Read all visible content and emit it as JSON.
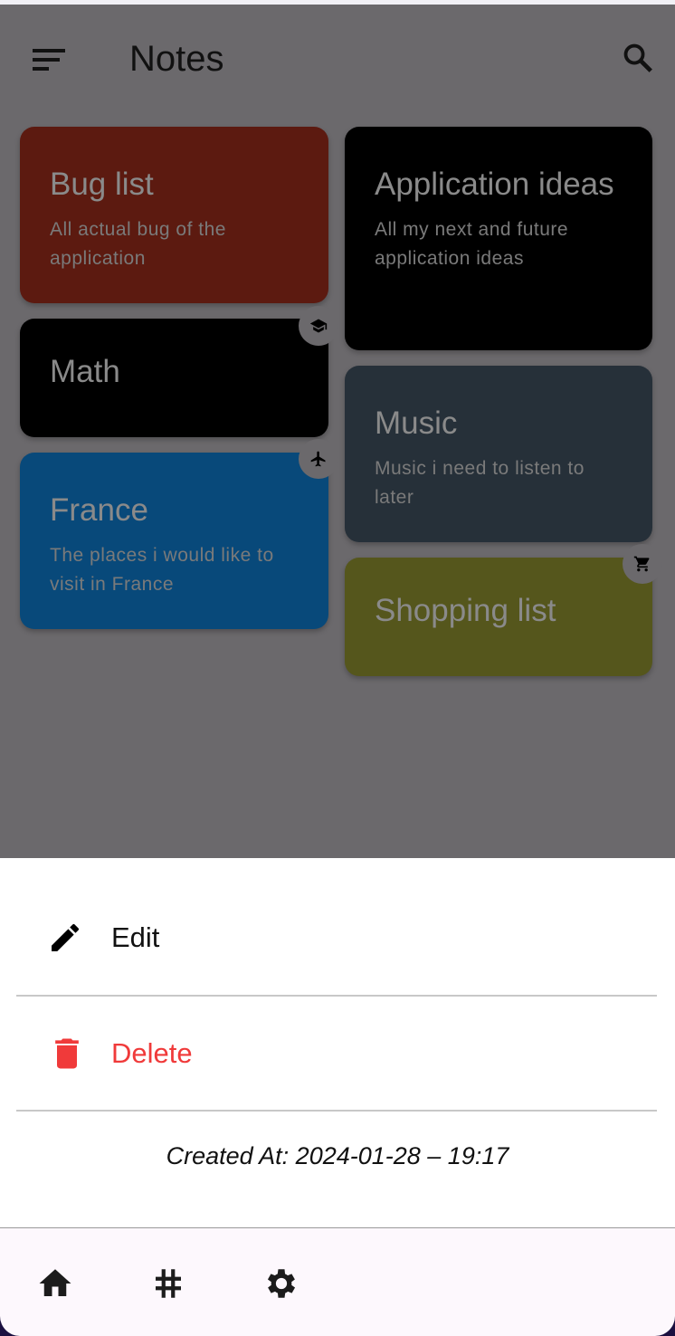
{
  "header": {
    "title": "Notes",
    "menu_icon": "sort-menu-icon",
    "search_icon": "search-icon"
  },
  "notes": [
    {
      "title": "Bug list",
      "description": "All actual bug of the application",
      "color": "#5c1a10"
    },
    {
      "title": "Math",
      "description": "",
      "color": "#000000",
      "badge_icon": "school-icon"
    },
    {
      "title": "France",
      "description": "The places i would like to visit in France",
      "color": "#08497a",
      "badge_icon": "airplane-icon"
    },
    {
      "title": "Application ideas",
      "description": "All my next and future application ideas",
      "color": "#000000"
    },
    {
      "title": "Music",
      "description": "Music i need to listen to later",
      "color": "#263039"
    },
    {
      "title": "Shopping list",
      "description": "",
      "color": "#55561c",
      "badge_icon": "cart-icon"
    }
  ],
  "sheet": {
    "edit_label": "Edit",
    "delete_label": "Delete",
    "delete_color": "#f03a3a",
    "created_at": "Created At: 2024-01-28 – 19:17"
  },
  "nav": {
    "items": [
      "home-icon",
      "hashtag-icon",
      "settings-icon"
    ]
  }
}
